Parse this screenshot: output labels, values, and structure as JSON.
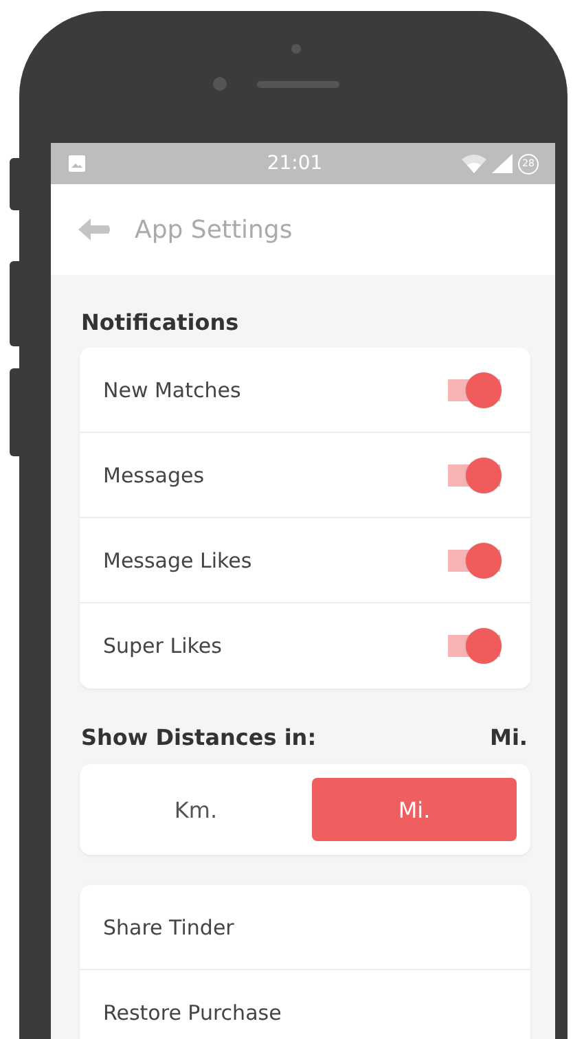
{
  "status_bar": {
    "time": "21:01",
    "battery": "28"
  },
  "header": {
    "title": "App Settings"
  },
  "notifications": {
    "heading": "Notifications",
    "items": [
      {
        "label": "New Matches",
        "on": true
      },
      {
        "label": "Messages",
        "on": true
      },
      {
        "label": "Message Likes",
        "on": true
      },
      {
        "label": "Super Likes",
        "on": true
      }
    ]
  },
  "distance": {
    "heading": "Show Distances in:",
    "value": "Mi.",
    "options": [
      {
        "label": "Km.",
        "selected": false
      },
      {
        "label": "Mi.",
        "selected": true
      }
    ]
  },
  "links": [
    "Share Tinder",
    "Restore Purchase"
  ]
}
